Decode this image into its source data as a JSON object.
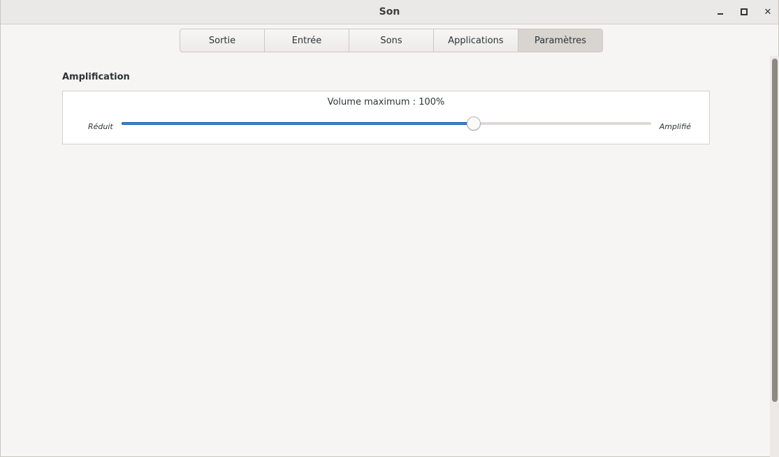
{
  "window": {
    "title": "Son"
  },
  "window_controls": {
    "minimize_icon": "minimize-icon",
    "maximize_icon": "maximize-icon",
    "close_icon": "close-icon",
    "close_glyph": "✕"
  },
  "tabs": [
    {
      "label": "Sortie",
      "active": false
    },
    {
      "label": "Entrée",
      "active": false
    },
    {
      "label": "Sons",
      "active": false
    },
    {
      "label": "Applications",
      "active": false
    },
    {
      "label": "Paramètres",
      "active": true
    }
  ],
  "amplification": {
    "section_title": "Amplification",
    "volume_label": "Volume maximum : 100%",
    "min_label": "Réduit",
    "max_label": "Amplifié",
    "slider_fraction": 0.665
  },
  "colors": {
    "accent": "#3584e4",
    "background": "#f6f5f4"
  }
}
